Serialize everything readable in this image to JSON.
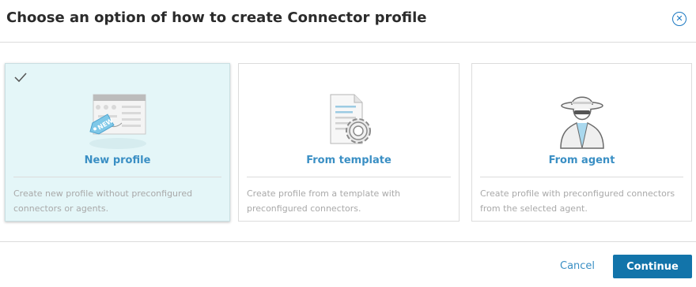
{
  "dialog": {
    "title": "Choose an option of how to create Connector profile",
    "close_icon": "close-circle-icon"
  },
  "options": [
    {
      "label": "New profile",
      "description": "Create new profile without preconfigured connectors or agents.",
      "icon": "new-profile-icon",
      "selected": true
    },
    {
      "label": "From template",
      "description": "Create profile from a template with preconfigured connectors.",
      "icon": "template-gear-icon",
      "selected": false
    },
    {
      "label": "From agent",
      "description": "Create profile with preconfigured connectors from the selected agent.",
      "icon": "agent-spy-icon",
      "selected": false
    }
  ],
  "footer": {
    "cancel_label": "Cancel",
    "continue_label": "Continue"
  },
  "colors": {
    "accent": "#3a8fc4",
    "primary_button": "#1274aa",
    "selected_bg": "#e4f6f8"
  }
}
